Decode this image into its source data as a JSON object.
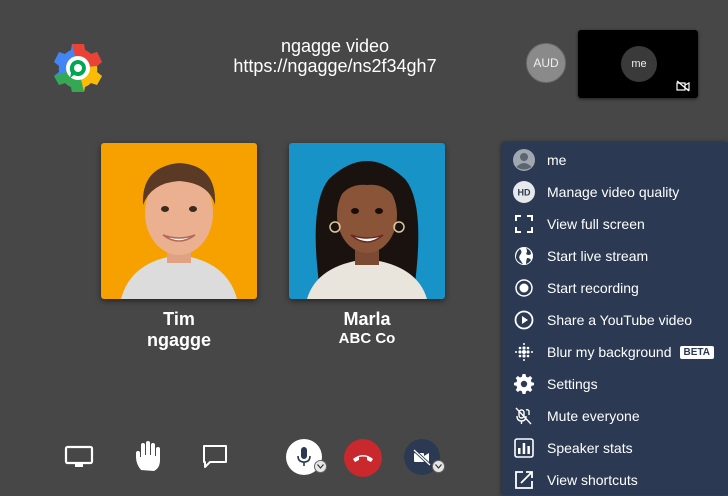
{
  "header": {
    "title": "ngagge video",
    "url": "https://ngagge/ns2f34gh7"
  },
  "participants_bar": {
    "aud_avatar": "AUD",
    "self_avatar": "me",
    "self_camera_icon": "camera-off-icon"
  },
  "participants": [
    {
      "name": "Tim",
      "subtitle": "ngagge",
      "tile_color": "#f7a100"
    },
    {
      "name": "Marla",
      "subtitle": "ABC Co",
      "tile_color": "#1793c7"
    }
  ],
  "menu": {
    "background": "#2b3a52",
    "items": [
      {
        "label": "me",
        "icon": "user-avatar-icon"
      },
      {
        "label": "Manage video quality",
        "icon": "hd-icon"
      },
      {
        "label": "View full screen",
        "icon": "fullscreen-icon"
      },
      {
        "label": "Start live stream",
        "icon": "globe-icon"
      },
      {
        "label": "Start recording",
        "icon": "record-icon"
      },
      {
        "label": "Share a YouTube video",
        "icon": "play-icon"
      },
      {
        "label": "Blur my background",
        "icon": "blur-icon",
        "badge": "BETA"
      },
      {
        "label": "Settings",
        "icon": "gear-icon"
      },
      {
        "label": "Mute everyone",
        "icon": "mute-all-icon"
      },
      {
        "label": "Speaker stats",
        "icon": "stats-icon"
      },
      {
        "label": "View shortcuts",
        "icon": "shortcuts-icon"
      }
    ]
  },
  "toolbar": {
    "buttons": [
      "screen-share-icon",
      "raise-hand-icon",
      "chat-icon",
      "microphone-icon",
      "hangup-icon",
      "camera-off-icon"
    ],
    "hangup_color": "#c9282d"
  }
}
